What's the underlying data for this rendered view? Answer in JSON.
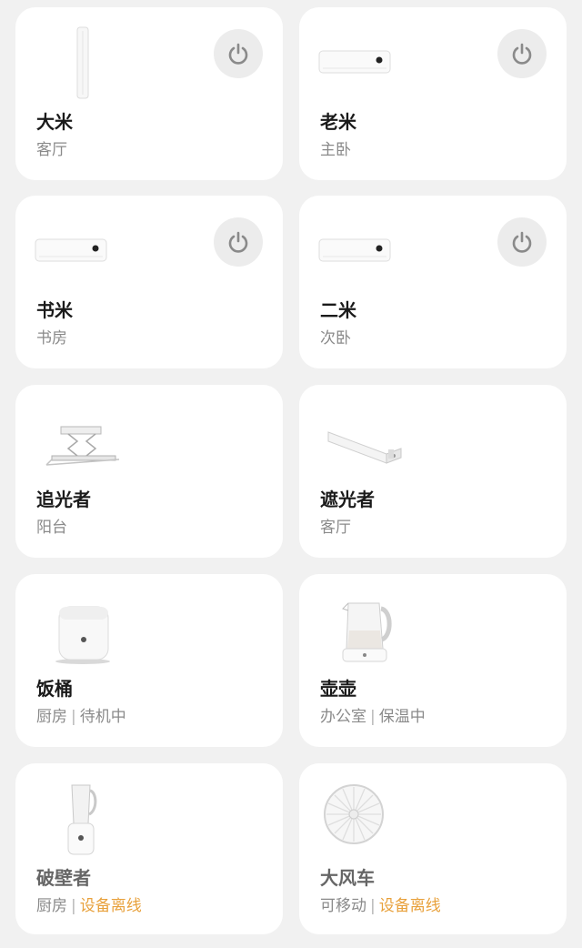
{
  "colors": {
    "offline": "#e8a13c",
    "card": "#ffffff",
    "background": "#f1f1f1"
  },
  "devices": [
    {
      "name": "大米",
      "room": "客厅",
      "icon": "standing-ac-icon",
      "power_icon": "power-icon"
    },
    {
      "name": "老米",
      "room": "主卧",
      "icon": "wall-ac-icon",
      "power_icon": "power-icon"
    },
    {
      "name": "书米",
      "room": "书房",
      "icon": "wall-ac-icon",
      "power_icon": "power-icon"
    },
    {
      "name": "二米",
      "room": "次卧",
      "icon": "wall-ac-icon",
      "power_icon": "power-icon"
    },
    {
      "name": "追光者",
      "room": "阳台",
      "icon": "clothes-dryer-icon"
    },
    {
      "name": "遮光者",
      "room": "客厅",
      "icon": "curtain-motor-icon"
    },
    {
      "name": "饭桶",
      "room": "厨房",
      "status": "待机中",
      "icon": "rice-cooker-icon"
    },
    {
      "name": "壶壶",
      "room": "办公室",
      "status": "保温中",
      "icon": "kettle-icon"
    },
    {
      "name": "破壁者",
      "room": "厨房",
      "status": "设备离线",
      "icon": "blender-icon"
    },
    {
      "name": "大风车",
      "room": "可移动",
      "status": "设备离线",
      "icon": "fan-icon"
    }
  ]
}
